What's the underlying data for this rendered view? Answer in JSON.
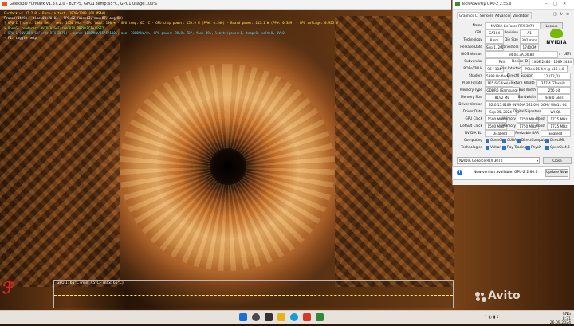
{
  "furmark": {
    "title": "Geeks3D FurMark v1.37.2.0 - 82FPS, GPU1 temp:65°C, GPU1 usage:100%",
    "osd_lines": [
      {
        "text": "FurMark v1.37.2.0 - Burn-in test, 1920x1080 (0X MSAA)",
        "color": "yellow"
      },
      {
        "text": "Frames:14993 - time:00:30:01 - FPS:82 (min:63, max:87, avg:83)",
        "color": "white"
      },
      {
        "text": "[ GPU-Z ] core: 1080 MHz - mem: 1750 MHz - GPU load: 100 % - GPU temp: 65 °C - GPU chip power: 153.9 W (PPW: 0.540) - Board power: 215.1 W (PPW: 0.389) - GPU voltage: 0.925 V",
        "color": "yellow"
      },
      {
        "text": "> OpenGL renderer: NVIDIA GeForce RTX 3070/PCIe/SSE2",
        "color": "green"
      },
      {
        "text": "> GPU 1 (NVIDIA GeForce RTX 3070) - core: 1080MHz/65°C/100%, mem: 7000MHz/6%, GPU power: 98.8% TDP, fan: 49%, limits(power:1, temp:0, volt:0, OV:0)",
        "color": "cyan"
      },
      {
        "text": "- F1: toggle help",
        "color": "white"
      }
    ],
    "graph_label": "GPU 1: 65°C (min: 45°C - max: 65°C)"
  },
  "gpuz": {
    "title": "TechPowerUp GPU-Z 2.55.0",
    "tabs": [
      "Graphics Card",
      "Sensors",
      "Advanced",
      "Validation"
    ],
    "lookup_label": "Lookup",
    "vendor_logo_text": "NVIDIA",
    "rows": {
      "name": {
        "label": "Name",
        "value": "NVIDIA GeForce RTX 3070"
      },
      "gpu": {
        "label": "GPU",
        "value": "GA104",
        "label2": "Revision",
        "value2": "A1"
      },
      "technology": {
        "label": "Technology",
        "value": "8 nm",
        "label2": "Die Size",
        "value2": "392 mm²"
      },
      "release": {
        "label": "Release Date",
        "value": "Sep 1, 2020",
        "label2": "Transistors",
        "value2": "17400M"
      },
      "bios": {
        "label": "BIOS Version",
        "value": "94.04.3A.00.88",
        "uefi": "UEFI"
      },
      "subvendor": {
        "label": "Subvendor",
        "value": "Palit",
        "label2": "Device ID",
        "value2": "10DE 2484 - 1569 2484"
      },
      "rops": {
        "label": "ROPs/TMUs",
        "value": "96 / 184",
        "label2": "Bus Interface",
        "value2": "PCIe x16 4.0 @ x16 4.0",
        "help": "?"
      },
      "shaders": {
        "label": "Shaders",
        "value": "5888 Unified",
        "label2": "DirectX Support",
        "value2": "12 (12_2)"
      },
      "pixel": {
        "label": "Pixel Fillrate",
        "value": "165.6 GPixel/s",
        "label2": "Texture Fillrate",
        "value2": "317.4 GTexel/s"
      },
      "memtype": {
        "label": "Memory Type",
        "value": "GDDR6 (Samsung)",
        "label2": "Bus Width",
        "value2": "256 bit"
      },
      "memsize": {
        "label": "Memory Size",
        "value": "8192 MB",
        "label2": "Bandwidth",
        "value2": "448.0 GB/s"
      },
      "driver": {
        "label": "Driver Version",
        "value": "32.0.15.6109 (NVIDIA 561.09) DCH / Win11 64"
      },
      "driverdate": {
        "label": "Driver Date",
        "value": "Sep 05, 2024",
        "label2": "Digital Signature",
        "value2": "WHQL"
      },
      "gpuclock": {
        "label": "GPU Clock",
        "value": "1500 MHz",
        "label2": "Memory",
        "value2": "1750 MHz",
        "label3": "Boost",
        "value3": "1725 MHz"
      },
      "defclock": {
        "label": "Default Clock",
        "value": "1500 MHz",
        "label2": "Memory",
        "value2": "1750 MHz",
        "label3": "Boost",
        "value3": "1725 MHz"
      },
      "sli": {
        "label": "NVIDIA SLI",
        "value": "Disabled",
        "label2": "Resizable BAR",
        "value2": "Enabled"
      },
      "computing": {
        "label": "Computing",
        "items": [
          "OpenCL",
          "CUDA",
          "DirectCompute",
          "DirectML"
        ]
      },
      "technologies": {
        "label": "Technologies",
        "items": [
          "Vulkan",
          "Ray Tracing",
          "PhysX",
          "OpenGL 4.6"
        ]
      }
    },
    "card_select": "NVIDIA GeForce RTX 3070",
    "close_label": "Close"
  },
  "notification": {
    "message": "New version available: GPU-Z 2.60.0",
    "update_label": "Update Now"
  },
  "taskbar": {
    "tray_lang": "ENG",
    "time": "8:31",
    "date": "26.09.2024"
  },
  "watermark": "Avito",
  "colors": {
    "osd_yellow": "#ffe44a",
    "osd_green": "#7bff7b",
    "osd_cyan": "#58d8ff",
    "nvidia_green": "#76b900",
    "accent_blue": "#1e6fd9"
  }
}
